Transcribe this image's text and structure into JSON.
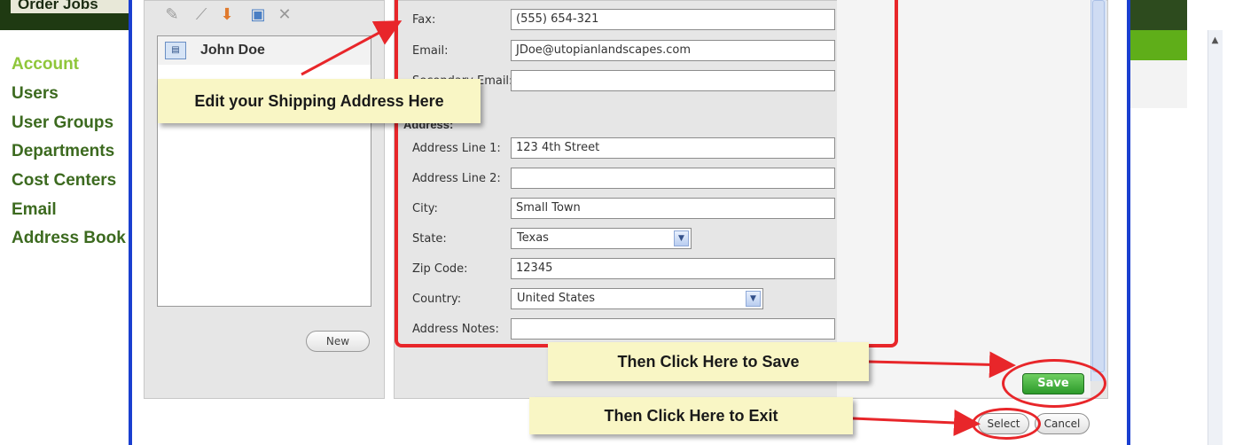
{
  "site_nav": {
    "banner": "Order Jobs",
    "items": [
      "Account",
      "Users",
      "User Groups",
      "Departments",
      "Cost Centers",
      "Email",
      "Address Book"
    ],
    "active_index": 0
  },
  "address_list": {
    "contact_name": "John Doe",
    "new_label": "New"
  },
  "form": {
    "fax": {
      "label": "Fax:",
      "value": "(555) 654-321"
    },
    "email": {
      "label": "Email:",
      "value": "JDoe@utopianlandscapes.com"
    },
    "secondary_email": {
      "label": "Secondary Email:",
      "value": ""
    },
    "address_heading": "Address:",
    "address_line_1": {
      "label": "Address Line 1:",
      "value": "123 4th Street"
    },
    "address_line_2": {
      "label": "Address Line 2:",
      "value": ""
    },
    "city": {
      "label": "City:",
      "value": "Small Town"
    },
    "state": {
      "label": "State:",
      "value": "Texas"
    },
    "zip": {
      "label": "Zip Code:",
      "value": "12345"
    },
    "country": {
      "label": "Country:",
      "value": "United States"
    },
    "address_notes": {
      "label": "Address Notes:",
      "value": ""
    }
  },
  "buttons": {
    "save": "Save",
    "select": "Select",
    "cancel": "Cancel"
  },
  "callouts": {
    "edit": "Edit your Shipping Address Here",
    "save": "Then Click Here to Save",
    "exit": "Then Click Here to Exit"
  },
  "colors": {
    "annotation_red": "#e8262a",
    "modal_border": "#1a3fd0",
    "nav_green": "#3c6a1f",
    "nav_active": "#8fc63a",
    "save_green": "#2c9a2a",
    "callout_yellow": "#f9f6c5"
  }
}
